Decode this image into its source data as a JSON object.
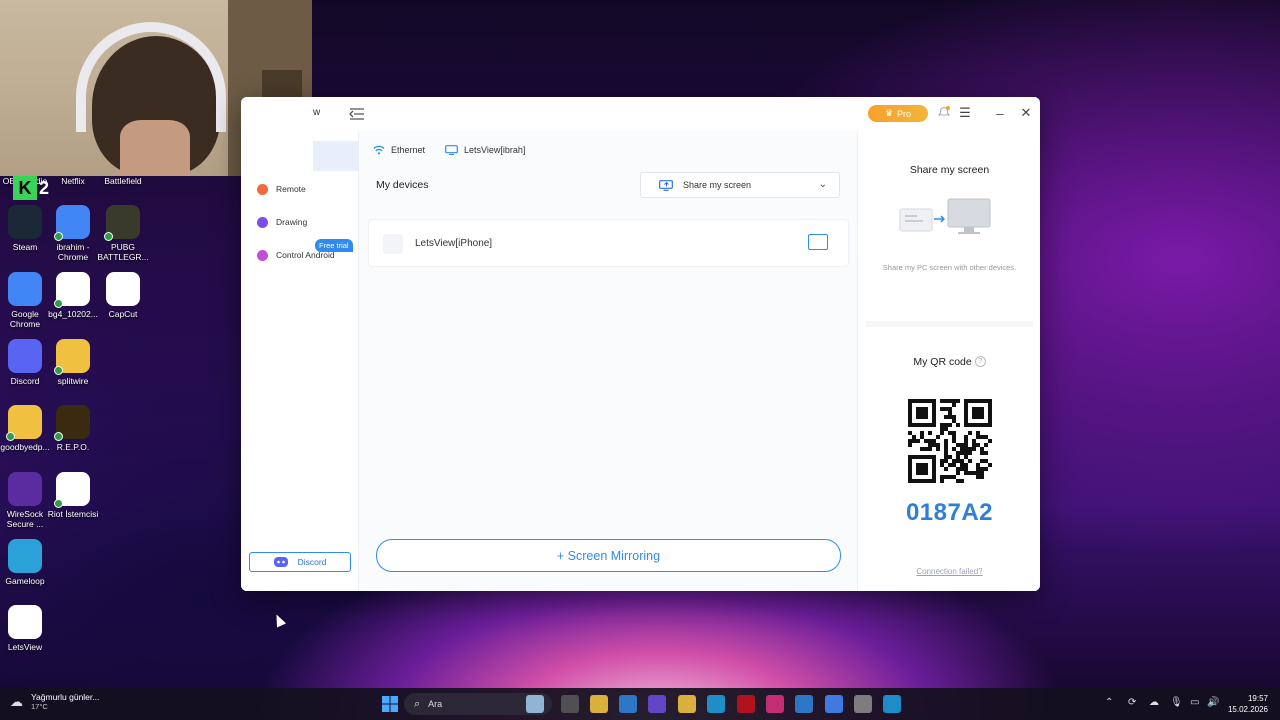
{
  "desktop": {
    "icons": [
      {
        "label": "OBS Studio",
        "color": "#2b2b2b"
      },
      {
        "label": "Netflix",
        "color": "#c1121f"
      },
      {
        "label": "Battlefield",
        "color": "#4a4a4a"
      },
      {
        "label": "Steam",
        "color": "#1b2838"
      },
      {
        "label": "ibrahim - Chrome",
        "color": "#4285f4"
      },
      {
        "label": "PUBG BATTLEGR...",
        "color": "#3a3a2a"
      },
      {
        "label": "Google Chrome",
        "color": "#4285f4"
      },
      {
        "label": "bg4_10202...",
        "color": "#ffffff"
      },
      {
        "label": "CapCut",
        "color": "#ffffff"
      },
      {
        "label": "Discord",
        "color": "#5865f2"
      },
      {
        "label": "splitwire",
        "color": "#f0c040"
      },
      {
        "label": "goodbyedp...",
        "color": "#f0c040"
      },
      {
        "label": "R.E.P.O.",
        "color": "#3a2a10"
      },
      {
        "label": "WireSock Secure ...",
        "color": "#5a2ca0"
      },
      {
        "label": "Riot İstemcisi",
        "color": "#ffffff"
      },
      {
        "label": "Gameloop",
        "color": "#2aa1d8"
      },
      {
        "label": "LetsView",
        "color": "#ffffff"
      }
    ],
    "k2_label": "2"
  },
  "window": {
    "title_fragment": "w",
    "pro_label": "Pro",
    "sidebar": {
      "items": [
        {
          "label": "Remote",
          "color": "#f06a3c"
        },
        {
          "label": "Drawing",
          "color": "#7a4df0"
        },
        {
          "label": "Control Android",
          "color": "#c04ed8"
        }
      ],
      "free_trial": "Free trial",
      "discord_label": "Discord"
    },
    "main": {
      "network": [
        {
          "label": "Ethernet",
          "icon": "wifi-icon"
        },
        {
          "label": "LetsView[ibrah]",
          "icon": "monitor-icon"
        }
      ],
      "my_devices": "My devices",
      "share_select": "Share my screen",
      "devices": [
        {
          "name": "LetsView[iPhone]",
          "icon": "apple-icon"
        }
      ],
      "mirror_button": "+ Screen Mirroring"
    },
    "right_panel": {
      "share_title": "Share my screen",
      "share_sub": "Share my PC screen with other devices.",
      "qr_title": "My QR code",
      "code": "0187A2",
      "connection_failed": "Connection failed?"
    }
  },
  "taskbar": {
    "weather_text": "Yağmurlu günler...",
    "weather_temp": "17°C",
    "search_placeholder": "Ara",
    "time": "19:57",
    "date": "15.02.2026"
  }
}
